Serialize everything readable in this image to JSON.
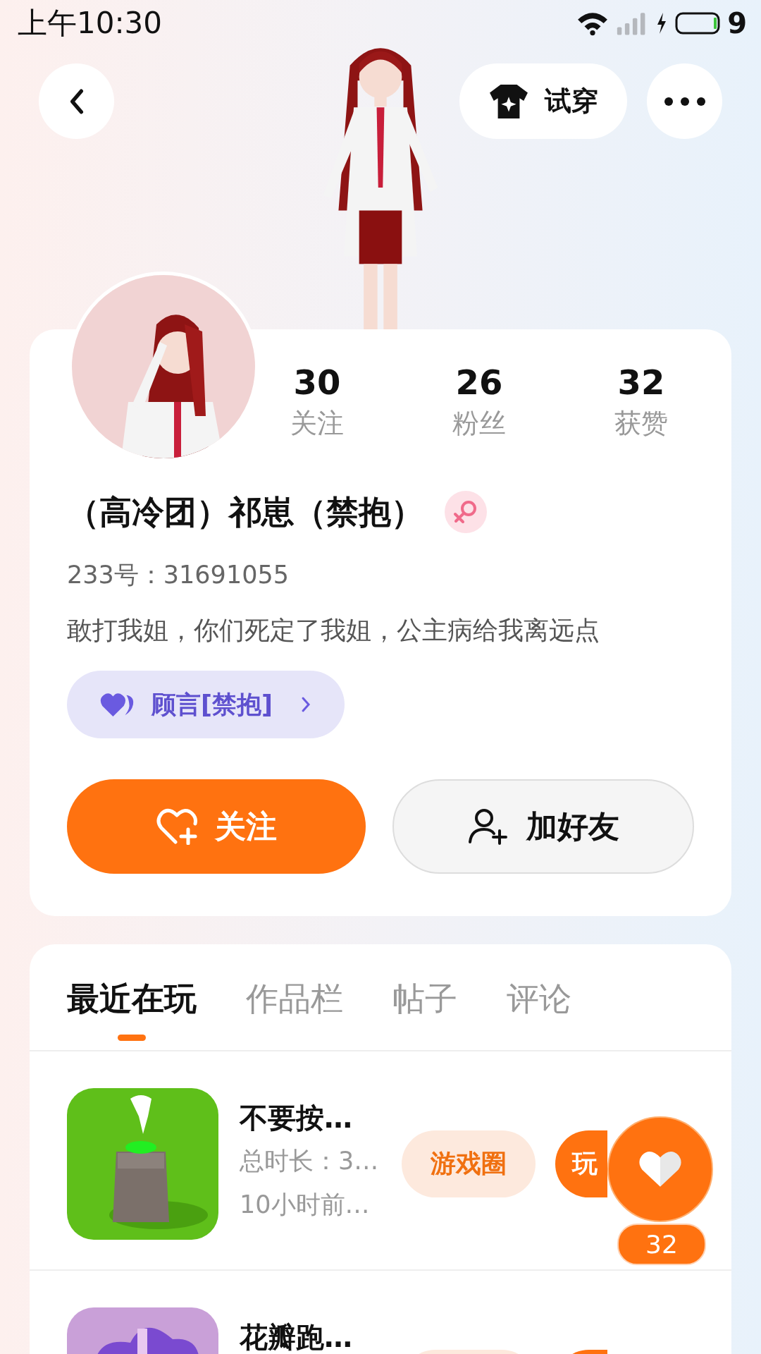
{
  "status_bar": {
    "time": "上午10:30",
    "battery": "9"
  },
  "header": {
    "try_on_label": "试穿"
  },
  "profile": {
    "stats": [
      {
        "value": "30",
        "label": "关注"
      },
      {
        "value": "26",
        "label": "粉丝"
      },
      {
        "value": "32",
        "label": "获赞"
      }
    ],
    "name": "（高冷团）祁崽（禁抱）",
    "is_female": true,
    "id_line": "233号：31691055",
    "bio": "敢打我姐，你们死定了我姐，公主病给我离远点",
    "relation_tag": {
      "label": "顾言[禁抱]"
    }
  },
  "actions": [
    {
      "kind": "follow",
      "label": "关注"
    },
    {
      "kind": "add_friend",
      "label": "加好友"
    }
  ],
  "tabs": [
    {
      "label": "最近在玩",
      "selected": true
    },
    {
      "label": "作品栏",
      "selected": false
    },
    {
      "label": "帖子",
      "selected": false
    },
    {
      "label": "评论",
      "selected": false
    }
  ],
  "games": [
    {
      "title": "不要按…",
      "duration": "总时长：3…",
      "last_played": "10小时前…",
      "circle_label": "游戏圈",
      "play_label": "玩"
    },
    {
      "title": "花瓣跑…"
    }
  ],
  "floating_like": {
    "count": "32"
  }
}
